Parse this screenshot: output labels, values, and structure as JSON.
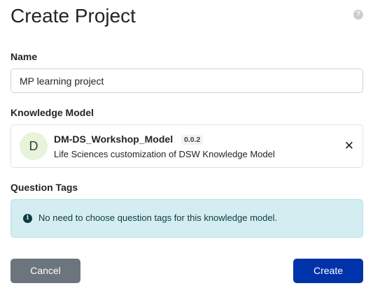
{
  "page": {
    "title": "Create Project",
    "help_icon": "question-circle-icon",
    "help_glyph": "?"
  },
  "name_field": {
    "label": "Name",
    "value": "MP learning project"
  },
  "knowledge_model": {
    "label": "Knowledge Model",
    "avatar_letter": "D",
    "name": "DM-DS_Workshop_Model",
    "version": "0.0.2",
    "description": "Life Sciences customization of DSW Knowledge Model",
    "remove_icon": "close-icon",
    "remove_glyph": "✕"
  },
  "question_tags": {
    "label": "Question Tags",
    "info_icon": "info-circle-icon",
    "info_glyph": "i",
    "message": "No need to choose question tags for this knowledge model."
  },
  "actions": {
    "cancel_label": "Cancel",
    "create_label": "Create"
  },
  "colors": {
    "primary": "#0033aa",
    "secondary": "#6c757d",
    "info_bg": "#d3edf1",
    "avatar_bg": "#e8f3dc"
  }
}
